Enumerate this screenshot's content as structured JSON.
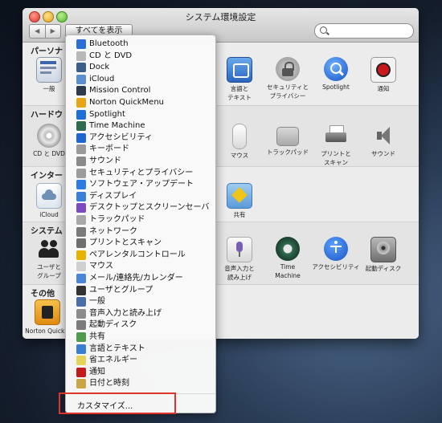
{
  "window": {
    "title": "システム環境設定"
  },
  "toolbar": {
    "back": "◀",
    "forward": "▶",
    "show_all": "すべてを表示",
    "search_placeholder": ""
  },
  "sections": {
    "personal": {
      "label": "パーソナ"
    },
    "hardware": {
      "label": "ハードウ"
    },
    "internet": {
      "label": "インター"
    },
    "system": {
      "label": "システム"
    },
    "other": {
      "label": "その他"
    }
  },
  "background_items": {
    "general": "一般",
    "language_text": "言語と\nテキスト",
    "security_privacy": "セキュリティと\nプライバシー",
    "spotlight": "Spotlight",
    "notifications": "通知",
    "cd_dvd": "CD と DVD",
    "mouse": "マウス",
    "trackpad": "トラックパッド",
    "print_scan": "プリントと\nスキャン",
    "sound": "サウンド",
    "icloud": "iCloud",
    "sharing": "共有",
    "users_groups": "ユーザと\nグループ",
    "dictation": "音声入力と\n読み上げ",
    "time_machine": "Time\nMachine",
    "accessibility": "アクセシビリティ",
    "startup_disk": "起動ディスク",
    "norton": "Norton QuickM"
  },
  "menu": {
    "items": [
      {
        "label": "Bluetooth",
        "icon": "bluetooth-icon",
        "color": "#2a6fd6"
      },
      {
        "label": "CD と DVD",
        "icon": "cd-dvd-icon",
        "color": "#b8b8b8"
      },
      {
        "label": "Dock",
        "icon": "dock-icon",
        "color": "#3c5f8a"
      },
      {
        "label": "iCloud",
        "icon": "icloud-icon",
        "color": "#5b8fd0"
      },
      {
        "label": "Mission Control",
        "icon": "mission-control-icon",
        "color": "#2d3a4e"
      },
      {
        "label": "Norton QuickMenu",
        "icon": "norton-icon",
        "color": "#e8a614"
      },
      {
        "label": "Spotlight",
        "icon": "spotlight-icon",
        "color": "#1f6fd8"
      },
      {
        "label": "Time Machine",
        "icon": "time-machine-icon",
        "color": "#2f6b4f"
      },
      {
        "label": "アクセシビリティ",
        "icon": "accessibility-icon",
        "color": "#1f66d0"
      },
      {
        "label": "キーボード",
        "icon": "keyboard-icon",
        "color": "#9a9a9a"
      },
      {
        "label": "サウンド",
        "icon": "sound-icon",
        "color": "#8a8a8a"
      },
      {
        "label": "セキュリティとプライバシー",
        "icon": "security-icon",
        "color": "#9c9c9c"
      },
      {
        "label": "ソフトウェア・アップデート",
        "icon": "software-update-icon",
        "color": "#2d7be0"
      },
      {
        "label": "ディスプレイ",
        "icon": "display-icon",
        "color": "#3a7fd8"
      },
      {
        "label": "デスクトップとスクリーンセーバ",
        "icon": "desktop-icon",
        "color": "#7a4cc0"
      },
      {
        "label": "トラックパッド",
        "icon": "trackpad-icon",
        "color": "#a8a8a8"
      },
      {
        "label": "ネットワーク",
        "icon": "network-icon",
        "color": "#7a7a7a"
      },
      {
        "label": "プリントとスキャン",
        "icon": "printer-icon",
        "color": "#6f6f6f"
      },
      {
        "label": "ペアレンタルコントロール",
        "icon": "parental-icon",
        "color": "#e7b300"
      },
      {
        "label": "マウス",
        "icon": "mouse-icon",
        "color": "#d0d0d0"
      },
      {
        "label": "メール/連絡先/カレンダー",
        "icon": "mail-icon",
        "color": "#4a86d8"
      },
      {
        "label": "ユーザとグループ",
        "icon": "users-icon",
        "color": "#333333"
      },
      {
        "label": "一般",
        "icon": "general-icon",
        "color": "#4d6fa8"
      },
      {
        "label": "音声入力と読み上げ",
        "icon": "microphone-icon",
        "color": "#8c8c8c"
      },
      {
        "label": "起動ディスク",
        "icon": "startup-disk-icon",
        "color": "#7c7c7c"
      },
      {
        "label": "共有",
        "icon": "sharing-icon",
        "color": "#4f9a4f"
      },
      {
        "label": "言語とテキスト",
        "icon": "language-icon",
        "color": "#3a7ed0"
      },
      {
        "label": "省エネルギー",
        "icon": "energy-icon",
        "color": "#e4d35a"
      },
      {
        "label": "通知",
        "icon": "notifications-icon",
        "color": "#c21a1a"
      },
      {
        "label": "日付と時刻",
        "icon": "date-time-icon",
        "color": "#c8a646"
      }
    ],
    "customize": "カスタマイズ..."
  }
}
